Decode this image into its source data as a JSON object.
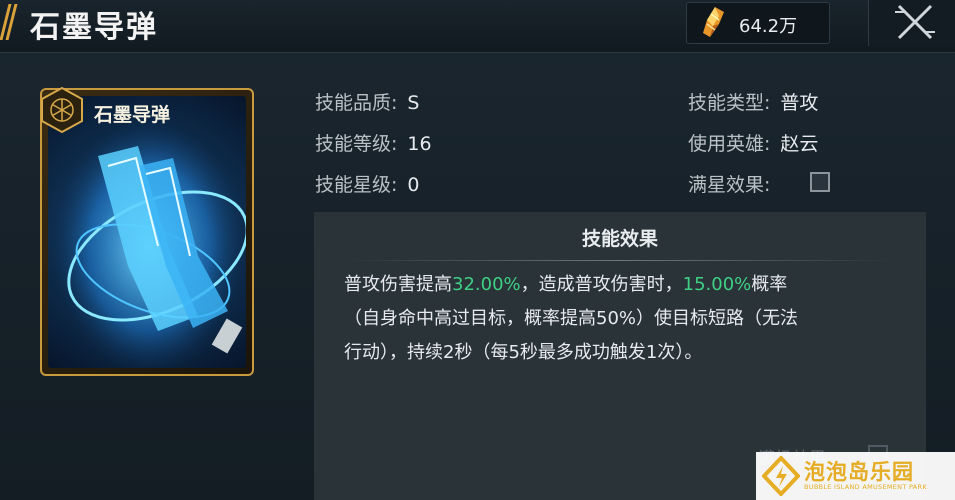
{
  "header": {
    "title": "石墨导弹",
    "currency": {
      "icon": "crystal-shard-icon",
      "value": "64.2万"
    },
    "close_icon": "close-icon"
  },
  "card": {
    "name": "石墨导弹",
    "emblem_icon": "hexagon-emblem-icon",
    "art": "blue-glowing-boots-art"
  },
  "info": {
    "quality": {
      "label": "技能品质:",
      "value": "S"
    },
    "level": {
      "label": "技能等级:",
      "value": "16"
    },
    "stars": {
      "label": "技能星级:",
      "value": "0"
    },
    "type": {
      "label": "技能类型:",
      "value": "普攻"
    },
    "hero": {
      "label": "使用英雄:",
      "value": "赵云"
    },
    "max_star": {
      "label": "满星效果:",
      "checked": false
    }
  },
  "effect": {
    "title": "技能效果",
    "text_1": "普攻伤害提高",
    "pct_1": "32.00%",
    "text_2": "，造成普攻伤害时，",
    "pct_2": "15.00%",
    "text_3": "概率",
    "line_2": "（自身命中高过目标，概率提高50%）使目标短路（无法",
    "line_3": "行动），持续2秒（每5秒最多成功触发1次）。",
    "faded_label": "满级效果"
  },
  "watermark": {
    "text": "泡泡岛乐园",
    "subtext": "BUBBLE ISLAND AMUSEMENT PARK"
  },
  "colors": {
    "highlight": "#3fcf85",
    "gold": "#c89a3e",
    "watermark": "#f0b323"
  }
}
